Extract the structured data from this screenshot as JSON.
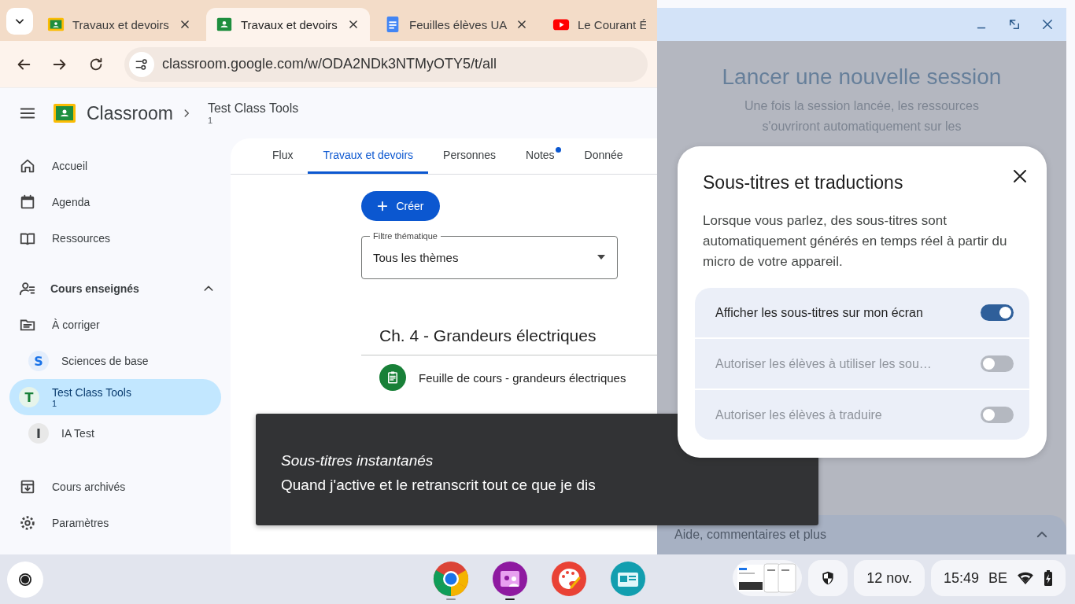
{
  "browser": {
    "tabs": [
      {
        "title": "Travaux et devoirs",
        "selected": false
      },
      {
        "title": "Travaux et devoirs",
        "selected": true
      },
      {
        "title": "Feuilles élèves UA",
        "selected": false
      },
      {
        "title": "Le Courant É",
        "selected": false
      }
    ],
    "url": "classroom.google.com/w/ODA2NDk3NTMyOTY5/t/all"
  },
  "classroom": {
    "app_name": "Classroom",
    "breadcrumb": {
      "title": "Test Class Tools",
      "subtitle": "1"
    },
    "sidebar": {
      "top": [
        {
          "label": "Accueil",
          "selected": false
        },
        {
          "label": "Agenda",
          "selected": false
        },
        {
          "label": "Ressources",
          "selected": false
        }
      ],
      "section": {
        "label": "Cours enseignés",
        "expanded": true,
        "items": [
          {
            "kind": "link",
            "label": "À corriger",
            "selected": false
          },
          {
            "kind": "course",
            "initial": "S",
            "label": "Sciences de base",
            "color": "#1a73e8",
            "selected": false
          },
          {
            "kind": "course",
            "initial": "T",
            "label": "Test Class Tools",
            "subtitle": "1",
            "color": "#188038",
            "selected": true
          },
          {
            "kind": "course",
            "initial": "I",
            "label": "IA Test",
            "color": "#3c4043",
            "selected": false
          }
        ]
      },
      "bottom": [
        {
          "label": "Cours archivés",
          "selected": false
        },
        {
          "label": "Paramètres",
          "selected": false
        }
      ]
    },
    "tabs": [
      {
        "label": "Flux",
        "selected": false,
        "badge": false
      },
      {
        "label": "Travaux et devoirs",
        "selected": true,
        "badge": false
      },
      {
        "label": "Personnes",
        "selected": false,
        "badge": false
      },
      {
        "label": "Notes",
        "selected": false,
        "badge": true
      },
      {
        "label": "Donnée",
        "selected": false,
        "badge": false
      }
    ],
    "create_button": "Créer",
    "filter": {
      "label": "Filtre thématique",
      "value": "Tous les thèmes"
    },
    "topic": {
      "title": "Ch. 4 - Grandeurs électriques",
      "items": [
        {
          "title": "Feuille de cours - grandeurs électriques"
        }
      ]
    }
  },
  "side_panel": {
    "title": "Lancer une nouvelle session",
    "text": "Une fois la session lancée, les ressources s'ouvriront automatiquement sur les",
    "footer": "Aide, commentaires et plus"
  },
  "dialog": {
    "title": "Sous-titres et traductions",
    "text": "Lorsque vous parlez, des sous-titres sont automatiquement générés en temps réel à partir du micro de votre appareil.",
    "options": [
      {
        "label": "Afficher les sous-titres sur mon écran",
        "on": true,
        "disabled": false
      },
      {
        "label": "Autoriser les élèves à utiliser les sou…",
        "on": false,
        "disabled": true
      },
      {
        "label": "Autoriser les élèves à traduire",
        "on": false,
        "disabled": true
      }
    ]
  },
  "toast": {
    "title": "Sous-titres instantanés",
    "text": "Quand j'active et le retranscrit tout ce que je dis"
  },
  "taskbar": {
    "apps": [
      {
        "open": true,
        "active": false
      },
      {
        "open": true,
        "active": true
      },
      {
        "open": false
      },
      {
        "open": false
      }
    ],
    "date": "12 nov.",
    "time": "15:49",
    "keyboard": "BE"
  }
}
